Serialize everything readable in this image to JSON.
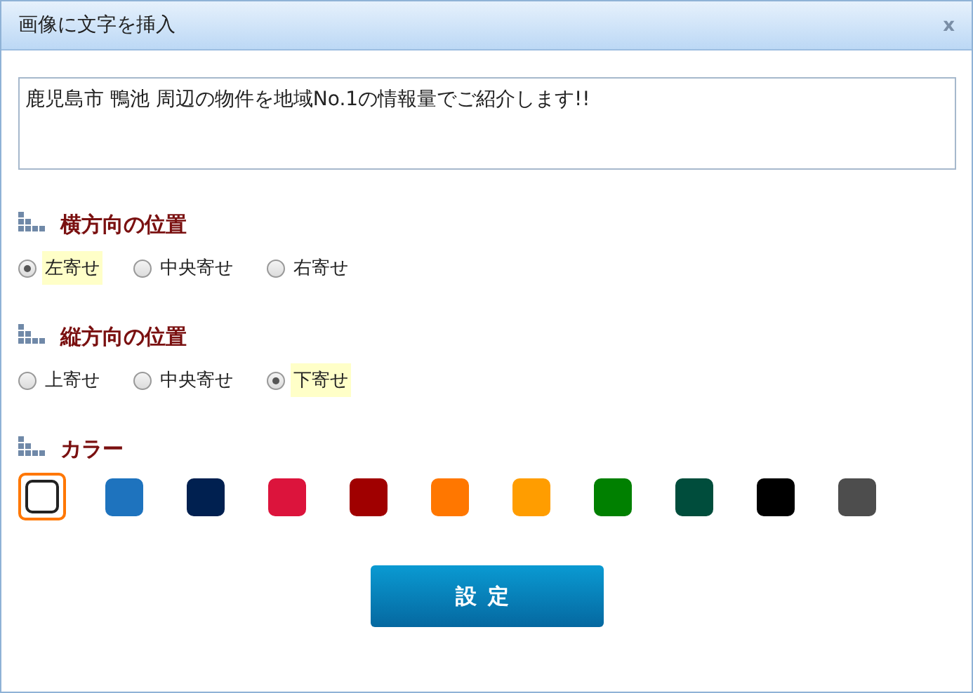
{
  "window": {
    "title": "画像に文字を挿入",
    "close": "x"
  },
  "text_field": {
    "value": "鹿児島市 鴨池 周辺の物件を地域No.1の情報量でご紹介します!!"
  },
  "sections": [
    {
      "kind": "radio",
      "heading": "横方向の位置",
      "options": [
        {
          "label": "左寄せ",
          "selected": true
        },
        {
          "label": "中央寄せ",
          "selected": false
        },
        {
          "label": "右寄せ",
          "selected": false
        }
      ]
    },
    {
      "kind": "radio",
      "heading": "縦方向の位置",
      "options": [
        {
          "label": "上寄せ",
          "selected": false
        },
        {
          "label": "中央寄せ",
          "selected": false
        },
        {
          "label": "下寄せ",
          "selected": true
        }
      ]
    },
    {
      "kind": "swatches",
      "heading": "カラー",
      "swatches": [
        {
          "color": "#ffffff",
          "selected": true
        },
        {
          "color": "#1e73be",
          "selected": false
        },
        {
          "color": "#002050",
          "selected": false
        },
        {
          "color": "#dc143c",
          "selected": false
        },
        {
          "color": "#a00000",
          "selected": false
        },
        {
          "color": "#ff7700",
          "selected": false
        },
        {
          "color": "#ff9d00",
          "selected": false
        },
        {
          "color": "#008000",
          "selected": false
        },
        {
          "color": "#004d3c",
          "selected": false
        },
        {
          "color": "#000000",
          "selected": false
        },
        {
          "color": "#4d4d4d",
          "selected": false
        }
      ]
    }
  ],
  "button": "設定"
}
